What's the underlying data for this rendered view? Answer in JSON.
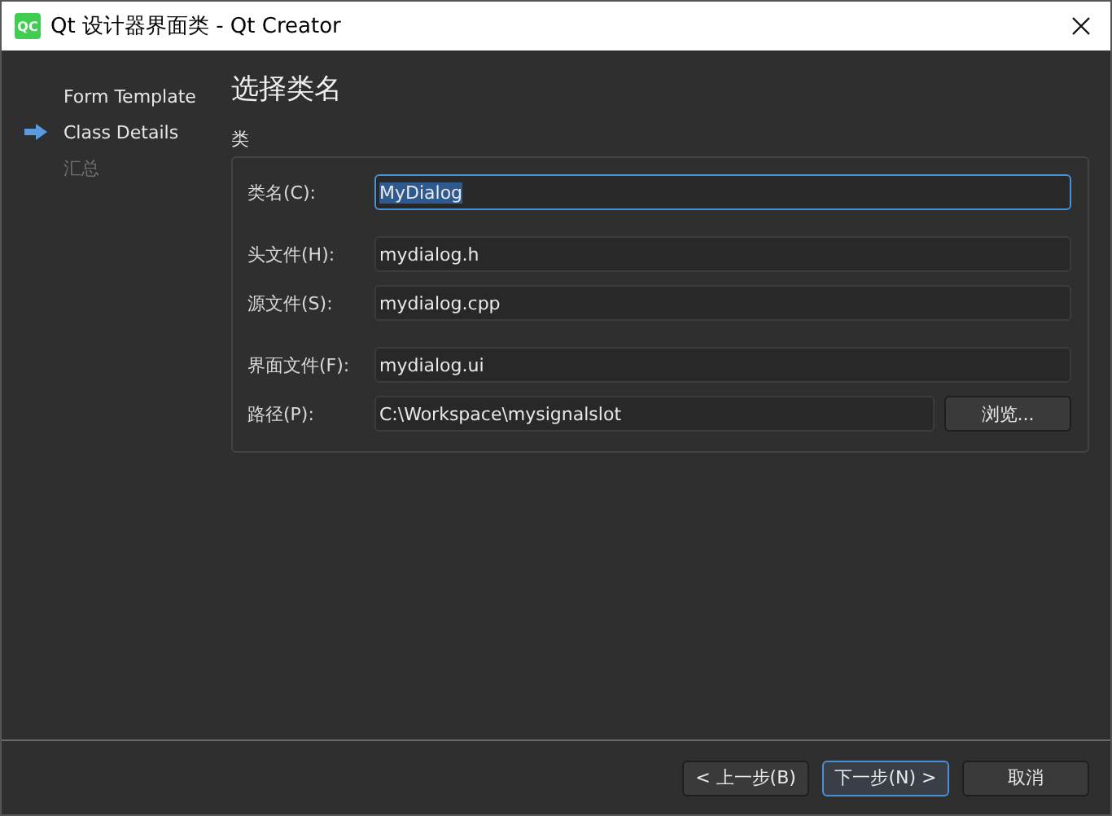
{
  "window": {
    "title": "Qt 设计器界面类 - Qt Creator",
    "app_icon": "QC"
  },
  "steps": [
    {
      "label": "Form Template",
      "selected": false,
      "disabled": false
    },
    {
      "label": "Class Details",
      "selected": true,
      "disabled": false
    },
    {
      "label": "汇总",
      "selected": false,
      "disabled": true
    }
  ],
  "page_title": "选择类名",
  "group": {
    "title": "类",
    "sections": [
      {
        "fields": [
          {
            "label": "类名(C):",
            "value": "MyDialog",
            "focused": true
          }
        ]
      },
      {
        "fields": [
          {
            "label": "头文件(H):",
            "value": "mydialog.h",
            "focused": false
          },
          {
            "label": "源文件(S):",
            "value": "mydialog.cpp",
            "focused": false
          }
        ]
      },
      {
        "fields": [
          {
            "label": "界面文件(F):",
            "value": "mydialog.ui",
            "focused": false
          },
          {
            "label": "路径(P):",
            "value": "C:\\Workspace\\mysignalslot",
            "focused": false,
            "button": "浏览..."
          }
        ]
      }
    ]
  },
  "buttons": [
    {
      "label": "< 上一步(B)",
      "default": false
    },
    {
      "label": "下一步(N) >",
      "default": true
    },
    {
      "label": "取消",
      "default": false
    }
  ]
}
